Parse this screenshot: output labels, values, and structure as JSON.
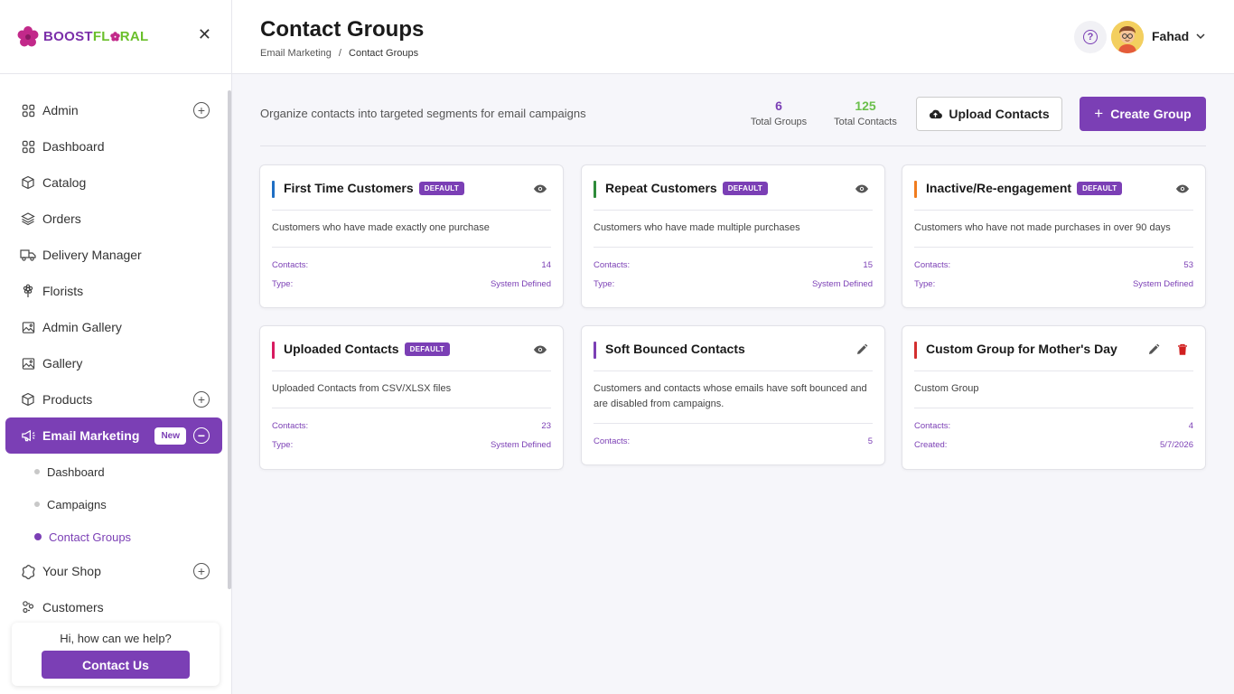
{
  "brand": {
    "part1": "BOOST",
    "part2": "FL",
    "part3": "RAL"
  },
  "sidebar": {
    "items": [
      {
        "label": "Admin"
      },
      {
        "label": "Dashboard"
      },
      {
        "label": "Catalog"
      },
      {
        "label": "Orders"
      },
      {
        "label": "Delivery Manager"
      },
      {
        "label": "Florists"
      },
      {
        "label": "Admin Gallery"
      },
      {
        "label": "Gallery"
      },
      {
        "label": "Products"
      },
      {
        "label": "Email Marketing",
        "badge": "New"
      },
      {
        "label": "Your Shop"
      },
      {
        "label": "Customers"
      }
    ],
    "sub_items": [
      {
        "label": "Dashboard"
      },
      {
        "label": "Campaigns"
      },
      {
        "label": "Contact Groups"
      }
    ],
    "help": {
      "question": "Hi, how can we help?",
      "button": "Contact Us"
    }
  },
  "header": {
    "title": "Contact Groups",
    "breadcrumb": {
      "parent": "Email Marketing",
      "sep": "/",
      "current": "Contact Groups"
    },
    "user": "Fahad"
  },
  "main": {
    "description": "Organize contacts into targeted segments for email campaigns",
    "stats": [
      {
        "value": "6",
        "label": "Total Groups",
        "color": "#7b3fb5"
      },
      {
        "value": "125",
        "label": "Total Contacts",
        "color": "#6abf4b"
      }
    ],
    "upload_label": "Upload Contacts",
    "create_label": "Create Group",
    "groups": [
      {
        "title": "First Time Customers",
        "default": "DEFAULT",
        "accent": "#1f6fc4",
        "desc": "Customers who have made exactly one purchase",
        "rows": [
          [
            "Contacts:",
            "14"
          ],
          [
            "Type:",
            "System Defined"
          ]
        ]
      },
      {
        "title": "Repeat Customers",
        "default": "DEFAULT",
        "accent": "#2e8b3a",
        "desc": "Customers who have made multiple purchases",
        "rows": [
          [
            "Contacts:",
            "15"
          ],
          [
            "Type:",
            "System Defined"
          ]
        ]
      },
      {
        "title": "Inactive/Re-engagement",
        "default": "DEFAULT",
        "accent": "#f07c1e",
        "desc": "Customers who have not made purchases in over 90 days",
        "rows": [
          [
            "Contacts:",
            "53"
          ],
          [
            "Type:",
            "System Defined"
          ]
        ]
      },
      {
        "title": "Uploaded Contacts",
        "default": "DEFAULT",
        "accent": "#d81b60",
        "desc": "Uploaded Contacts from CSV/XLSX files",
        "rows": [
          [
            "Contacts:",
            "23"
          ],
          [
            "Type:",
            "System Defined"
          ]
        ]
      },
      {
        "title": "Soft Bounced Contacts",
        "default": "",
        "accent": "#7b3fb5",
        "desc": "Customers and contacts whose emails have soft bounced and are disabled from campaigns.",
        "rows": [
          [
            "Contacts:",
            "5"
          ]
        ]
      },
      {
        "title": "Custom Group for Mother's Day",
        "default": "",
        "accent": "#d32f2f",
        "desc": "Custom Group",
        "rows": [
          [
            "Contacts:",
            "4"
          ],
          [
            "Created:",
            "5/7/2026"
          ]
        ]
      }
    ]
  }
}
